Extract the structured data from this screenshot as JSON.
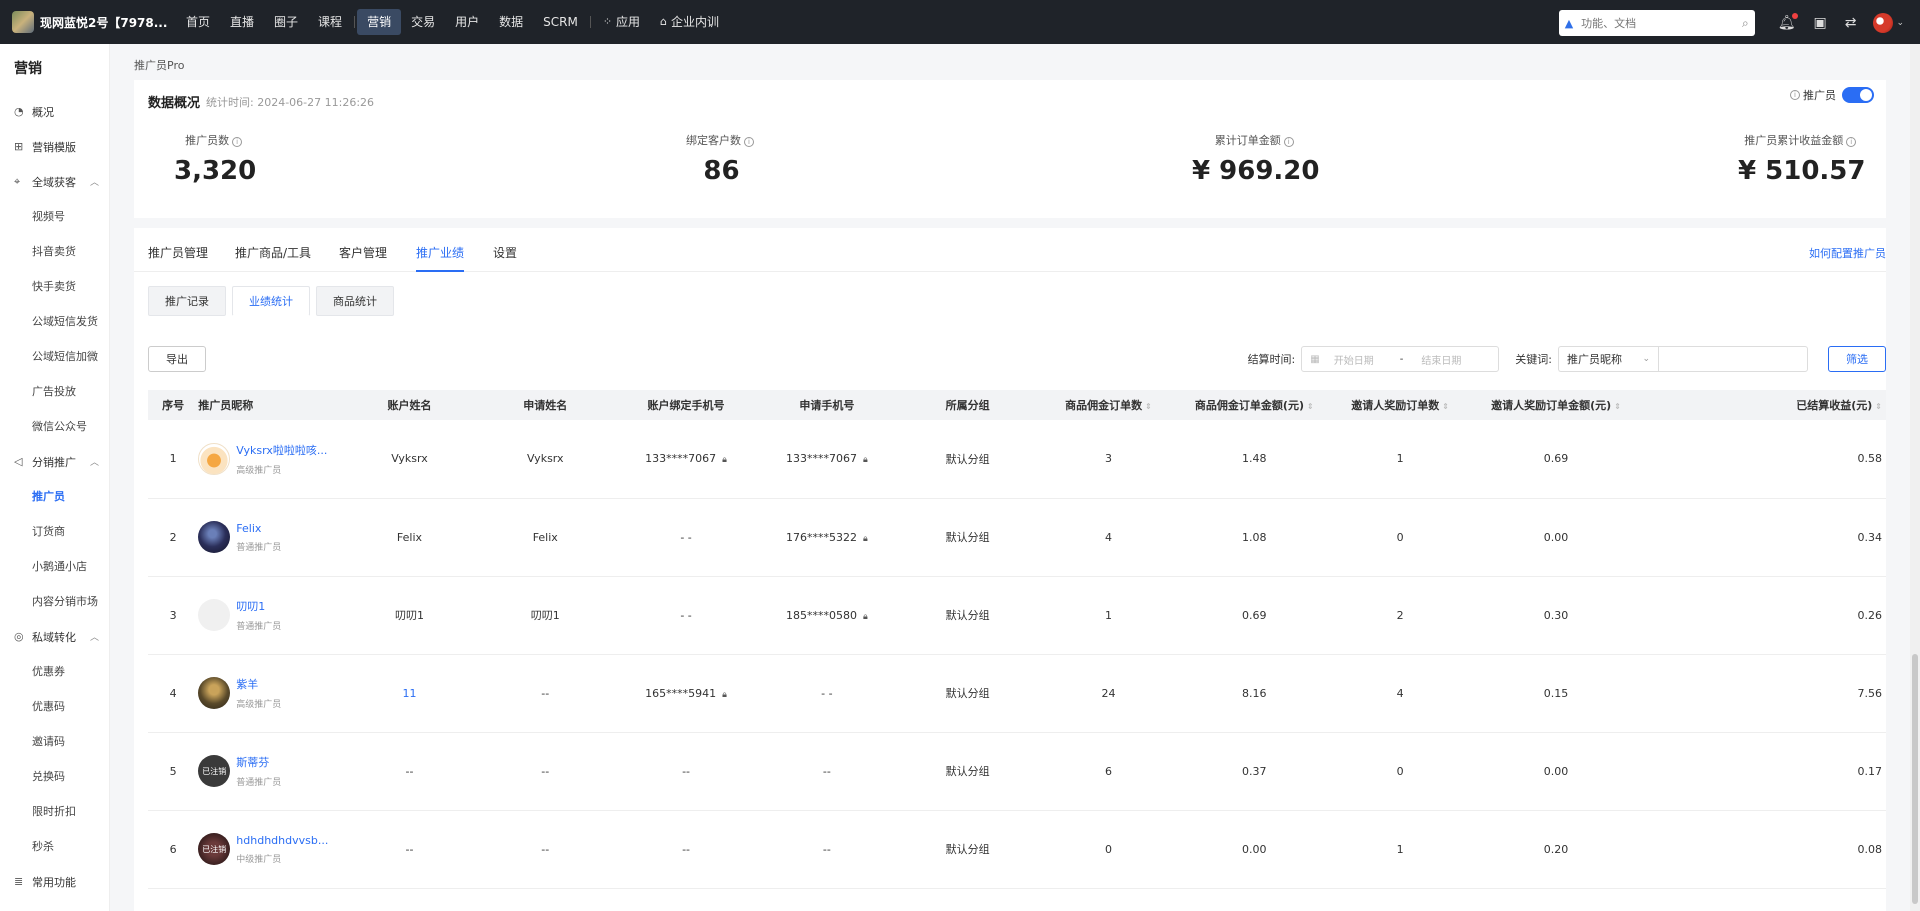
{
  "topbar": {
    "app_name": "现网蓝悦2号【7978...",
    "nav": [
      {
        "label": "首页"
      },
      {
        "label": "直播"
      },
      {
        "label": "圈子"
      },
      {
        "label": "课程"
      },
      {
        "label": "营销",
        "active": true
      },
      {
        "label": "交易"
      },
      {
        "label": "用户"
      },
      {
        "label": "数据"
      },
      {
        "label": "SCRM"
      },
      {
        "label": "应用"
      },
      {
        "label": "企业内训"
      }
    ],
    "search_placeholder": "功能、文档"
  },
  "sidebar": {
    "title": "营销",
    "items": [
      {
        "label": "概况",
        "icon": "pie-icon"
      },
      {
        "label": "营销模版",
        "icon": "grid-icon"
      },
      {
        "label": "全域获客",
        "icon": "target-icon",
        "expanded": true,
        "children": [
          "视频号",
          "抖音卖货",
          "快手卖货",
          "公域短信发货",
          "公域短信加微",
          "广告投放",
          "微信公众号"
        ]
      },
      {
        "label": "分销推广",
        "icon": "megaphone-icon",
        "expanded": true,
        "children": [
          "推广员",
          "订货商",
          "小鹅通小店",
          "内容分销市场"
        ],
        "active_child": "推广员"
      },
      {
        "label": "私域转化",
        "icon": "cycle-icon",
        "expanded": true,
        "children": [
          "优惠券",
          "优惠码",
          "邀请码",
          "兑换码",
          "限时折扣",
          "秒杀"
        ]
      },
      {
        "label": "常用功能",
        "icon": "list-icon"
      }
    ]
  },
  "breadcrumb": "推广员Pro",
  "overview": {
    "title": "数据概况",
    "time": "统计时间: 2024-06-27 11:26:26",
    "toggle_label": "推广员",
    "stats": [
      {
        "label": "推广员数",
        "value": "3,320"
      },
      {
        "label": "绑定客户数",
        "value": "86"
      },
      {
        "label": "累计订单金额",
        "value": "¥ 969.20"
      },
      {
        "label": "推广员累计收益金额",
        "value": "¥ 510.57"
      }
    ]
  },
  "tabs": [
    "推广员管理",
    "推广商品/工具",
    "客户管理",
    "推广业绩",
    "设置"
  ],
  "active_tab": "推广业绩",
  "help_link": "如何配置推广员",
  "subtabs": [
    "推广记录",
    "业绩统计",
    "商品统计"
  ],
  "active_subtab": "业绩统计",
  "toolbar": {
    "export_label": "导出",
    "settle_label": "结算时间:",
    "start_placeholder": "开始日期",
    "date_sep": "-",
    "end_placeholder": "结束日期",
    "keyword_label": "关键词:",
    "keyword_select": "推广员昵称",
    "filter_label": "筛选"
  },
  "table": {
    "columns": [
      "序号",
      "推广员昵称",
      "账户姓名",
      "申请姓名",
      "账户绑定手机号",
      "申请手机号",
      "所属分组",
      "商品佣金订单数",
      "商品佣金订单金额(元)",
      "邀请人奖励订单数",
      "邀请人奖励订单金额(元)",
      "已结算收益(元)"
    ],
    "rows": [
      {
        "no": "1",
        "name": "Vyksrx啦啦啦咳...",
        "level": "高级推广员",
        "account": "Vyksrx",
        "apply": "Vyksrx",
        "bind_phone": "133****7067",
        "bind_lock": true,
        "apply_phone": "133****7067",
        "apply_lock": true,
        "group": "默认分组",
        "orders": "3",
        "amount": "1.48",
        "inv_orders": "1",
        "inv_amount": "0.69",
        "settled": "0.58",
        "avatar": "fox"
      },
      {
        "no": "2",
        "name": "Felix",
        "level": "普通推广员",
        "account": "Felix",
        "apply": "Felix",
        "bind_phone": "- -",
        "bind_lock": false,
        "apply_phone": "176****5322",
        "apply_lock": true,
        "group": "默认分组",
        "orders": "4",
        "amount": "1.08",
        "inv_orders": "0",
        "inv_amount": "0.00",
        "settled": "0.34",
        "avatar": "dark"
      },
      {
        "no": "3",
        "name": "叨叨1",
        "level": "普通推广员",
        "account": "叨叨1",
        "apply": "叨叨1",
        "bind_phone": "- -",
        "bind_lock": false,
        "apply_phone": "185****0580",
        "apply_lock": true,
        "group": "默认分组",
        "orders": "1",
        "amount": "0.69",
        "inv_orders": "2",
        "inv_amount": "0.30",
        "settled": "0.26",
        "avatar": "blank"
      },
      {
        "no": "4",
        "name": "紫羊",
        "level": "高级推广员",
        "account": "11",
        "apply": "--",
        "bind_phone": "165****5941",
        "bind_lock": true,
        "apply_phone": "- -",
        "apply_lock": false,
        "group": "默认分组",
        "orders": "24",
        "amount": "8.16",
        "inv_orders": "4",
        "inv_amount": "0.15",
        "settled": "7.56",
        "avatar": "photo"
      },
      {
        "no": "5",
        "name": "斯蒂芬",
        "level": "普通推广员",
        "account": "--",
        "apply": "--",
        "bind_phone": "--",
        "bind_lock": false,
        "apply_phone": "--",
        "apply_lock": false,
        "group": "默认分组",
        "orders": "6",
        "amount": "0.37",
        "inv_orders": "0",
        "inv_amount": "0.00",
        "settled": "0.17",
        "avatar": "cancelled"
      },
      {
        "no": "6",
        "name": "hdhdhdhdvvsb...",
        "level": "中级推广员",
        "account": "--",
        "apply": "--",
        "bind_phone": "--",
        "bind_lock": false,
        "apply_phone": "--",
        "apply_lock": false,
        "group": "默认分组",
        "orders": "0",
        "amount": "0.00",
        "inv_orders": "1",
        "inv_amount": "0.20",
        "settled": "0.08",
        "avatar": "cancelled2"
      }
    ],
    "cancelled_badge": "已注销"
  },
  "colors": {
    "accent": "#2a6df4",
    "topbar": "#1f2329"
  }
}
